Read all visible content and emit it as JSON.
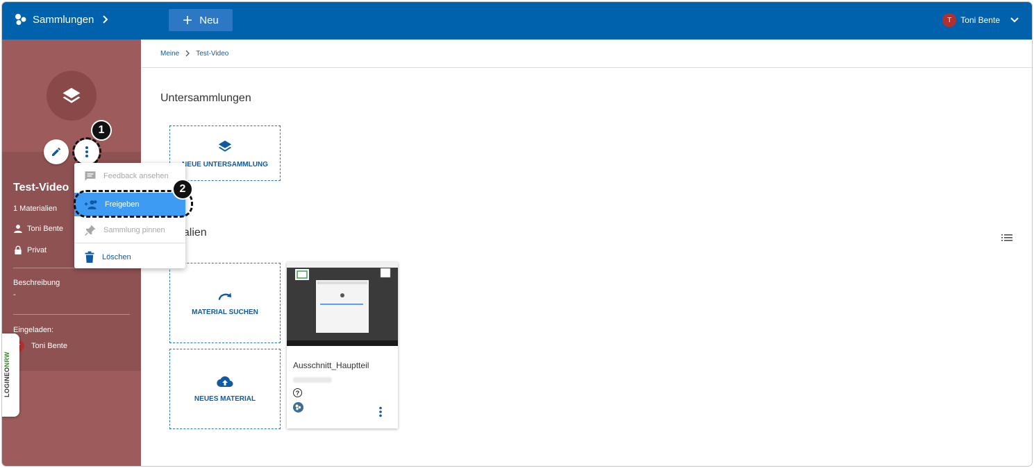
{
  "topbar": {
    "brand_label": "Sammlungen",
    "new_button_label": "Neu",
    "user_initial": "T",
    "user_name": "Toni Bente"
  },
  "breadcrumb": {
    "items": [
      "Meine",
      "Test-Video"
    ]
  },
  "collection": {
    "title": "Test-Video",
    "count_label": "1 Materialien",
    "owner": "Toni Bente",
    "visibility": "Privat",
    "description_label": "Beschreibung",
    "description_value": "-",
    "invited_label": "Eingeladen:",
    "invited_initial": "T",
    "invited_name": "Toni Bente"
  },
  "menu": {
    "items": [
      {
        "label": "Feedback ansehen",
        "icon": "feedback-icon",
        "state": "disabled"
      },
      {
        "label": "Freigeben",
        "icon": "share-people-icon",
        "state": "highlighted"
      },
      {
        "label": "Sammlung pinnen",
        "icon": "pin-icon",
        "state": "disabled"
      },
      {
        "label": "Löschen",
        "icon": "trash-icon",
        "state": "enabled"
      }
    ]
  },
  "steps": {
    "one": "1",
    "two": "2"
  },
  "sections": {
    "subcollections_heading": "Untersammlungen",
    "materials_heading": "rialien"
  },
  "tiles": {
    "new_subcollection": "NEUE UNTERSAMMLUNG",
    "search_material": "MATERIAL SUCHEN",
    "new_material": "NEUES MATERIAL"
  },
  "material_card": {
    "title": "Ausschnitt_Hauptteil",
    "license_glyph": "?"
  },
  "logineo": {
    "label_a": "LOGINEO",
    "label_b": "NRW"
  },
  "colors": {
    "primary": "#0062ad",
    "accent_highlight": "#3d9bf4",
    "side_panel": "#9e5b5b",
    "link": "#0f5aa3"
  }
}
